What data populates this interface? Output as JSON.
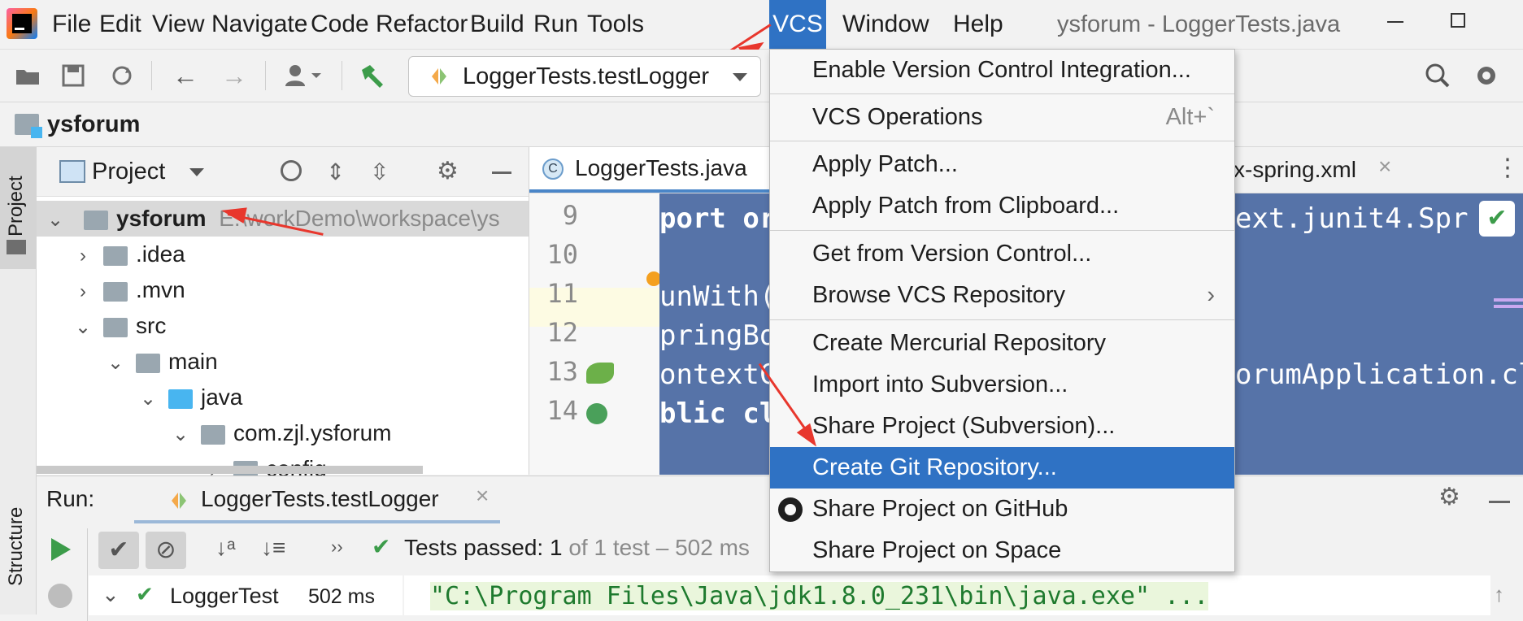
{
  "menubar": {
    "items": [
      "File",
      "Edit",
      "View",
      "Navigate",
      "Code",
      "Refactor",
      "Build",
      "Run",
      "Tools",
      "VCS",
      "Window",
      "Help"
    ],
    "active": "VCS",
    "window_title": "ysforum - LoggerTests.java"
  },
  "toolbar": {
    "run_config": "LoggerTests.testLogger"
  },
  "breadcrumb": {
    "project": "ysforum"
  },
  "leftstrip": {
    "project_label": "Project",
    "structure_label": "Structure"
  },
  "project_panel": {
    "title": "Project",
    "tree": [
      {
        "name": "ysforum",
        "path": "E:\\workDemo\\workspace\\ys"
      },
      {
        "name": ".idea"
      },
      {
        "name": ".mvn"
      },
      {
        "name": "src"
      },
      {
        "name": "main"
      },
      {
        "name": "java"
      },
      {
        "name": "com.zjl.ysforum"
      },
      {
        "name": "config"
      }
    ]
  },
  "editor": {
    "tabs": [
      {
        "label": "LoggerTests.java"
      },
      {
        "label": "x-spring.xml"
      }
    ],
    "line_numbers": [
      "9",
      "10",
      "11",
      "12",
      "13",
      "14"
    ],
    "code_lines": [
      {
        "left": "port or",
        "right": "ext.junit4.Spr"
      },
      {
        "left": "",
        "right": ""
      },
      {
        "left": "unWith(",
        "right": ""
      },
      {
        "left": "pringBo",
        "right": ""
      },
      {
        "left": "ontextC",
        "right": "orumApplication.cl"
      },
      {
        "left": "blic cl",
        "right": ""
      }
    ]
  },
  "vcs_menu": {
    "items": [
      {
        "label": "Enable Version Control Integration...",
        "shortcut": ""
      },
      {
        "label": "VCS Operations",
        "shortcut": "Alt+`"
      },
      {
        "label": "Apply Patch...",
        "shortcut": ""
      },
      {
        "label": "Apply Patch from Clipboard...",
        "shortcut": ""
      },
      {
        "label": "Get from Version Control...",
        "shortcut": ""
      },
      {
        "label": "Browse VCS Repository",
        "shortcut": ""
      },
      {
        "label": "Create Mercurial Repository",
        "shortcut": ""
      },
      {
        "label": "Import into Subversion...",
        "shortcut": ""
      },
      {
        "label": "Share Project (Subversion)...",
        "shortcut": ""
      },
      {
        "label": "Create Git Repository...",
        "shortcut": ""
      },
      {
        "label": "Share Project on GitHub",
        "shortcut": ""
      },
      {
        "label": "Share Project on Space",
        "shortcut": ""
      }
    ],
    "selected": "Create Git Repository..."
  },
  "run_panel": {
    "label": "Run:",
    "tab": "LoggerTests.testLogger",
    "status_prefix": "Tests passed:",
    "status_count": "1",
    "status_rest": "of 1 test – 502 ms",
    "tree_item": "LoggerTest",
    "tree_time": "502 ms",
    "console": "\"C:\\Program Files\\Java\\jdk1.8.0_231\\bin\\java.exe\" ..."
  },
  "colors": {
    "accent": "#2f72c4",
    "selection": "#5673a8",
    "annotation_arrow": "#e8372d",
    "passed": "#3c9c4a"
  }
}
